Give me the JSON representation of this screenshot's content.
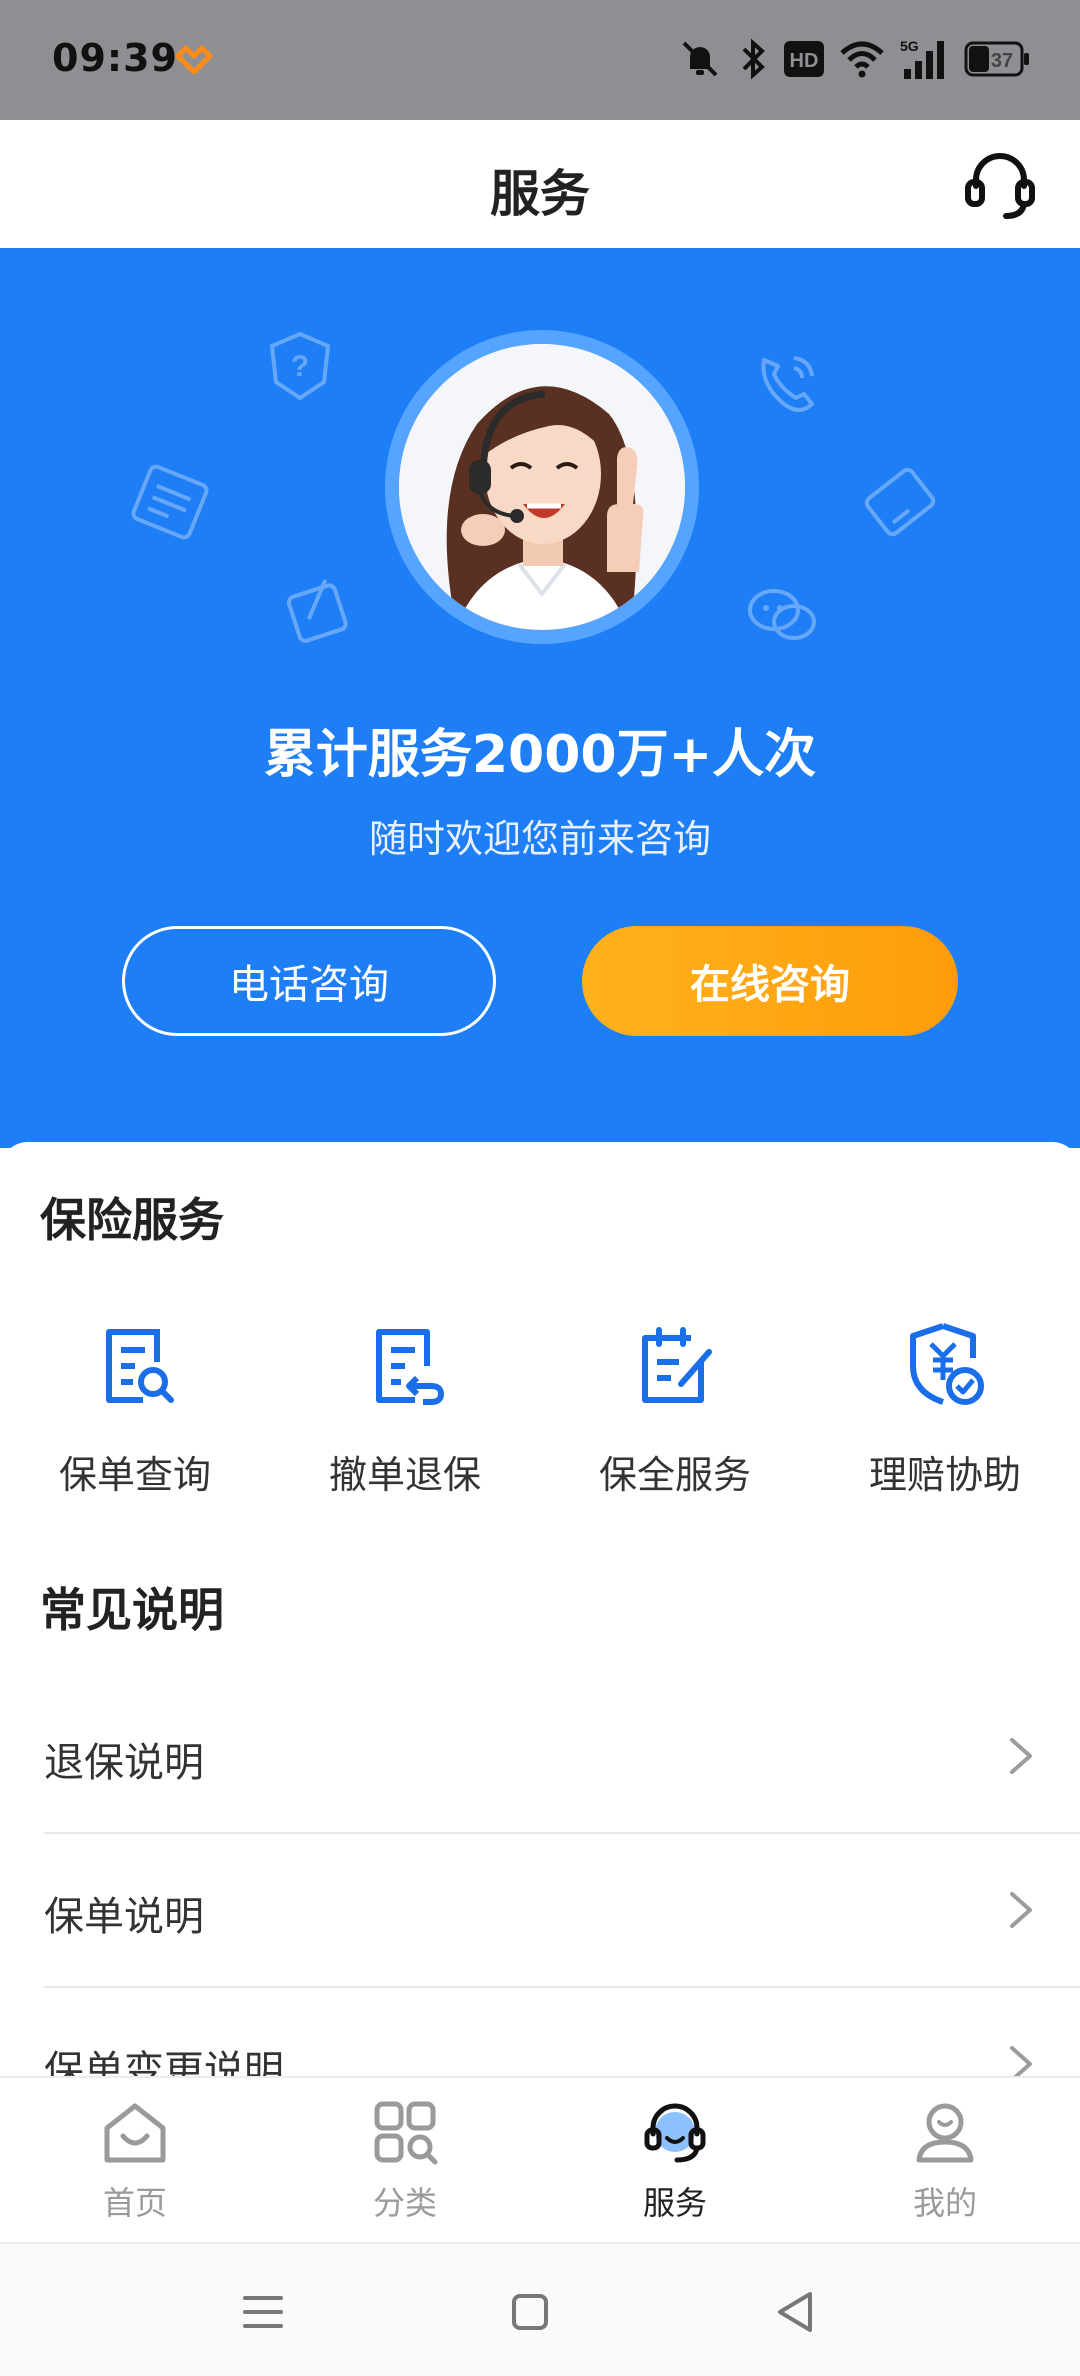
{
  "status_bar": {
    "time": "09:39",
    "battery": "37",
    "icons": [
      "muted-bell-icon",
      "bluetooth-icon",
      "hd-icon",
      "wifi-icon",
      "5g-signal-icon",
      "battery-icon"
    ]
  },
  "header": {
    "title": "服务",
    "action_icon": "headset-icon"
  },
  "hero": {
    "headline": "累计服务2000万+人次",
    "subtitle": "随时欢迎您前来咨询",
    "phone_button": "电话咨询",
    "online_button": "在线咨询",
    "colors": {
      "background": "#1e7ef5",
      "online_button": "#ffa414"
    }
  },
  "insurance_services": {
    "title": "保险服务",
    "items": [
      {
        "label": "保单查询",
        "icon": "policy-search-icon"
      },
      {
        "label": "撤单退保",
        "icon": "policy-return-icon"
      },
      {
        "label": "保全服务",
        "icon": "policy-edit-icon"
      },
      {
        "label": "理赔协助",
        "icon": "claim-shield-icon"
      }
    ]
  },
  "faq": {
    "title": "常见说明",
    "items": [
      {
        "label": "退保说明"
      },
      {
        "label": "保单说明"
      },
      {
        "label": "保单变更说明"
      }
    ]
  },
  "tab_bar": {
    "tabs": [
      {
        "label": "首页",
        "icon": "home-icon",
        "active": false
      },
      {
        "label": "分类",
        "icon": "category-grid-icon",
        "active": false
      },
      {
        "label": "服务",
        "icon": "service-headset-icon",
        "active": true
      },
      {
        "label": "我的",
        "icon": "profile-icon",
        "active": false
      }
    ]
  },
  "nav_bar": {
    "buttons": [
      "menu-icon",
      "home-square-icon",
      "back-triangle-icon"
    ]
  }
}
